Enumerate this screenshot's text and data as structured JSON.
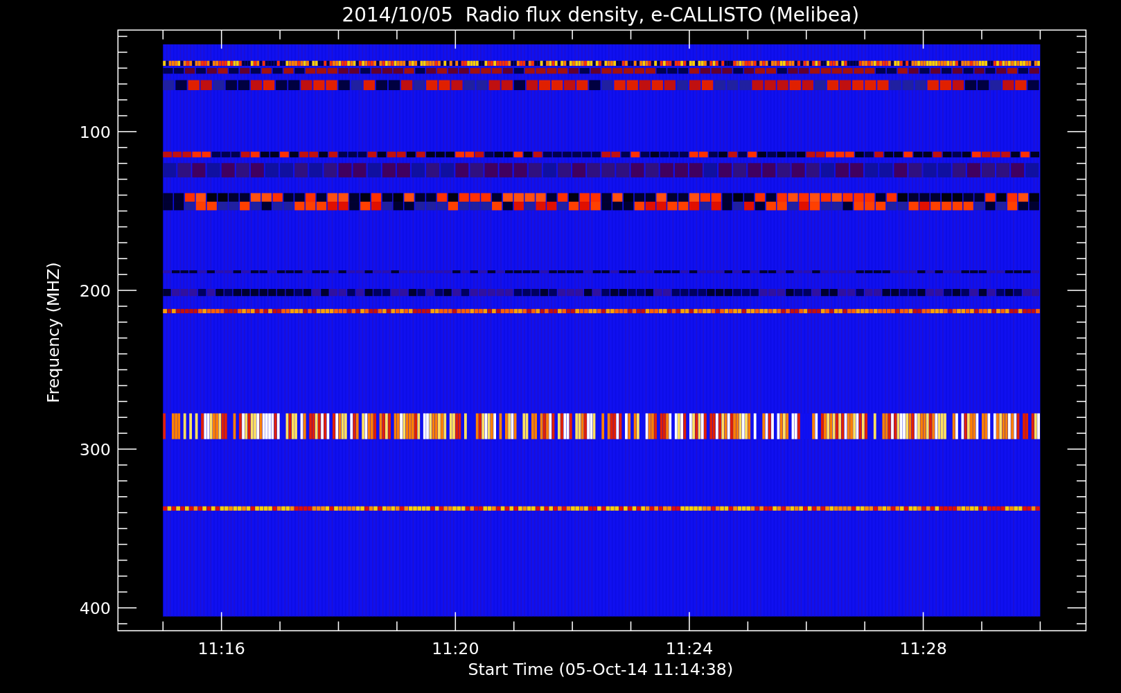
{
  "plot": {
    "title": "2014/10/05  Radio flux density, e-CALLISTO (Melibea)",
    "ylabel": "Frequency (MHZ)",
    "xlabel": "Start Time (05-Oct-14 11:14:38)",
    "y_tick_labels": [
      "100",
      "200",
      "300",
      "400"
    ],
    "x_tick_labels": [
      "11:16",
      "11:20",
      "11:24",
      "11:28"
    ]
  }
}
